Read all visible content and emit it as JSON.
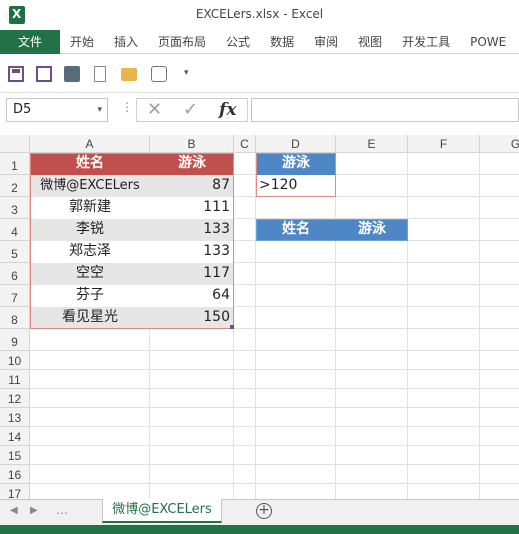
{
  "window": {
    "title": "EXCELers.xlsx - Excel"
  },
  "ribbon": {
    "tabs": [
      "文件",
      "开始",
      "插入",
      "页面布局",
      "公式",
      "数据",
      "审阅",
      "视图",
      "开发工具",
      "POWE"
    ]
  },
  "qat": {
    "icons": [
      "save-icon",
      "save-as-icon",
      "print-preview-icon",
      "new-file-icon",
      "open-folder-icon",
      "touch-mode-icon",
      "customize-qat-icon"
    ],
    "more_glyph": "▾"
  },
  "formula_bar": {
    "name_box": "D5",
    "dropdown_glyph": "▾",
    "separator": "⋮",
    "cancel_glyph": "✕",
    "enter_glyph": "✓",
    "fx_label": "fx",
    "formula": ""
  },
  "grid": {
    "columns": [
      "A",
      "B",
      "C",
      "D",
      "E",
      "F",
      "G"
    ],
    "rows": [
      "1",
      "2",
      "3",
      "4",
      "5",
      "6",
      "7",
      "8",
      "9",
      "10",
      "11",
      "12",
      "13",
      "14",
      "15",
      "16",
      "17"
    ],
    "table": {
      "headers": [
        "姓名",
        "游泳"
      ],
      "rows": [
        [
          "微博@EXCELers",
          "87"
        ],
        [
          "郭新建",
          "111"
        ],
        [
          "李锐",
          "133"
        ],
        [
          "郑志泽",
          "133"
        ],
        [
          "空空",
          "117"
        ],
        [
          "芬子",
          "64"
        ],
        [
          "看见星光",
          "150"
        ]
      ]
    },
    "criteria": {
      "header": "游泳",
      "value": ">120"
    },
    "output": {
      "headers": [
        "姓名",
        "游泳"
      ]
    }
  },
  "sheets": {
    "nav_prev": "◀",
    "nav_next": "▶",
    "nav_more": "…",
    "active": "微博@EXCELers",
    "add_glyph": "+"
  },
  "colors": {
    "accent": "#217346",
    "table_header": "#c0504d",
    "band": "#e7e6e6",
    "output_header": "#4f86c6"
  }
}
